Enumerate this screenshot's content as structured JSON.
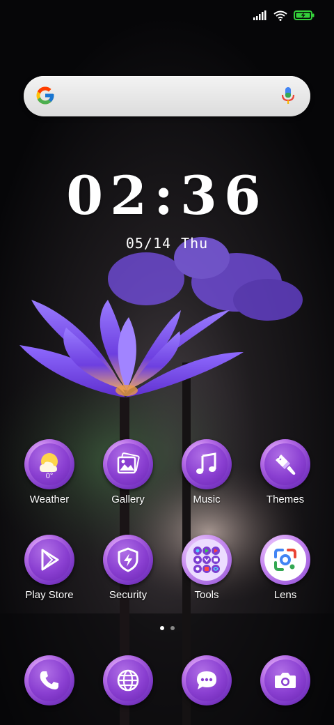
{
  "status_bar": {
    "signal_icon": "signal-icon",
    "wifi_icon": "wifi-icon",
    "battery_icon": "battery-charging-icon",
    "battery_color": "#34d03a"
  },
  "search": {
    "logo": "google-g-icon",
    "mic_icon": "mic-icon"
  },
  "clock": {
    "time": "02:36",
    "date": "05/14",
    "weekday": "Thu"
  },
  "home_apps": [
    {
      "label": "Weather",
      "icon": "weather-icon",
      "temp": "0°"
    },
    {
      "label": "Gallery",
      "icon": "gallery-icon"
    },
    {
      "label": "Music",
      "icon": "music-icon"
    },
    {
      "label": "Themes",
      "icon": "themes-icon"
    },
    {
      "label": "Play Store",
      "icon": "play-store-icon"
    },
    {
      "label": "Security",
      "icon": "security-icon"
    },
    {
      "label": "Tools",
      "icon": "tools-folder-icon"
    },
    {
      "label": "Lens",
      "icon": "lens-icon"
    }
  ],
  "page_indicator": {
    "pages": 2,
    "current": 1
  },
  "dock": [
    {
      "icon": "phone-icon"
    },
    {
      "icon": "browser-icon"
    },
    {
      "icon": "messages-icon"
    },
    {
      "icon": "camera-icon"
    }
  ],
  "colors": {
    "icon_purple": "#8a3fd1",
    "icon_light": "#f3c5ff"
  }
}
